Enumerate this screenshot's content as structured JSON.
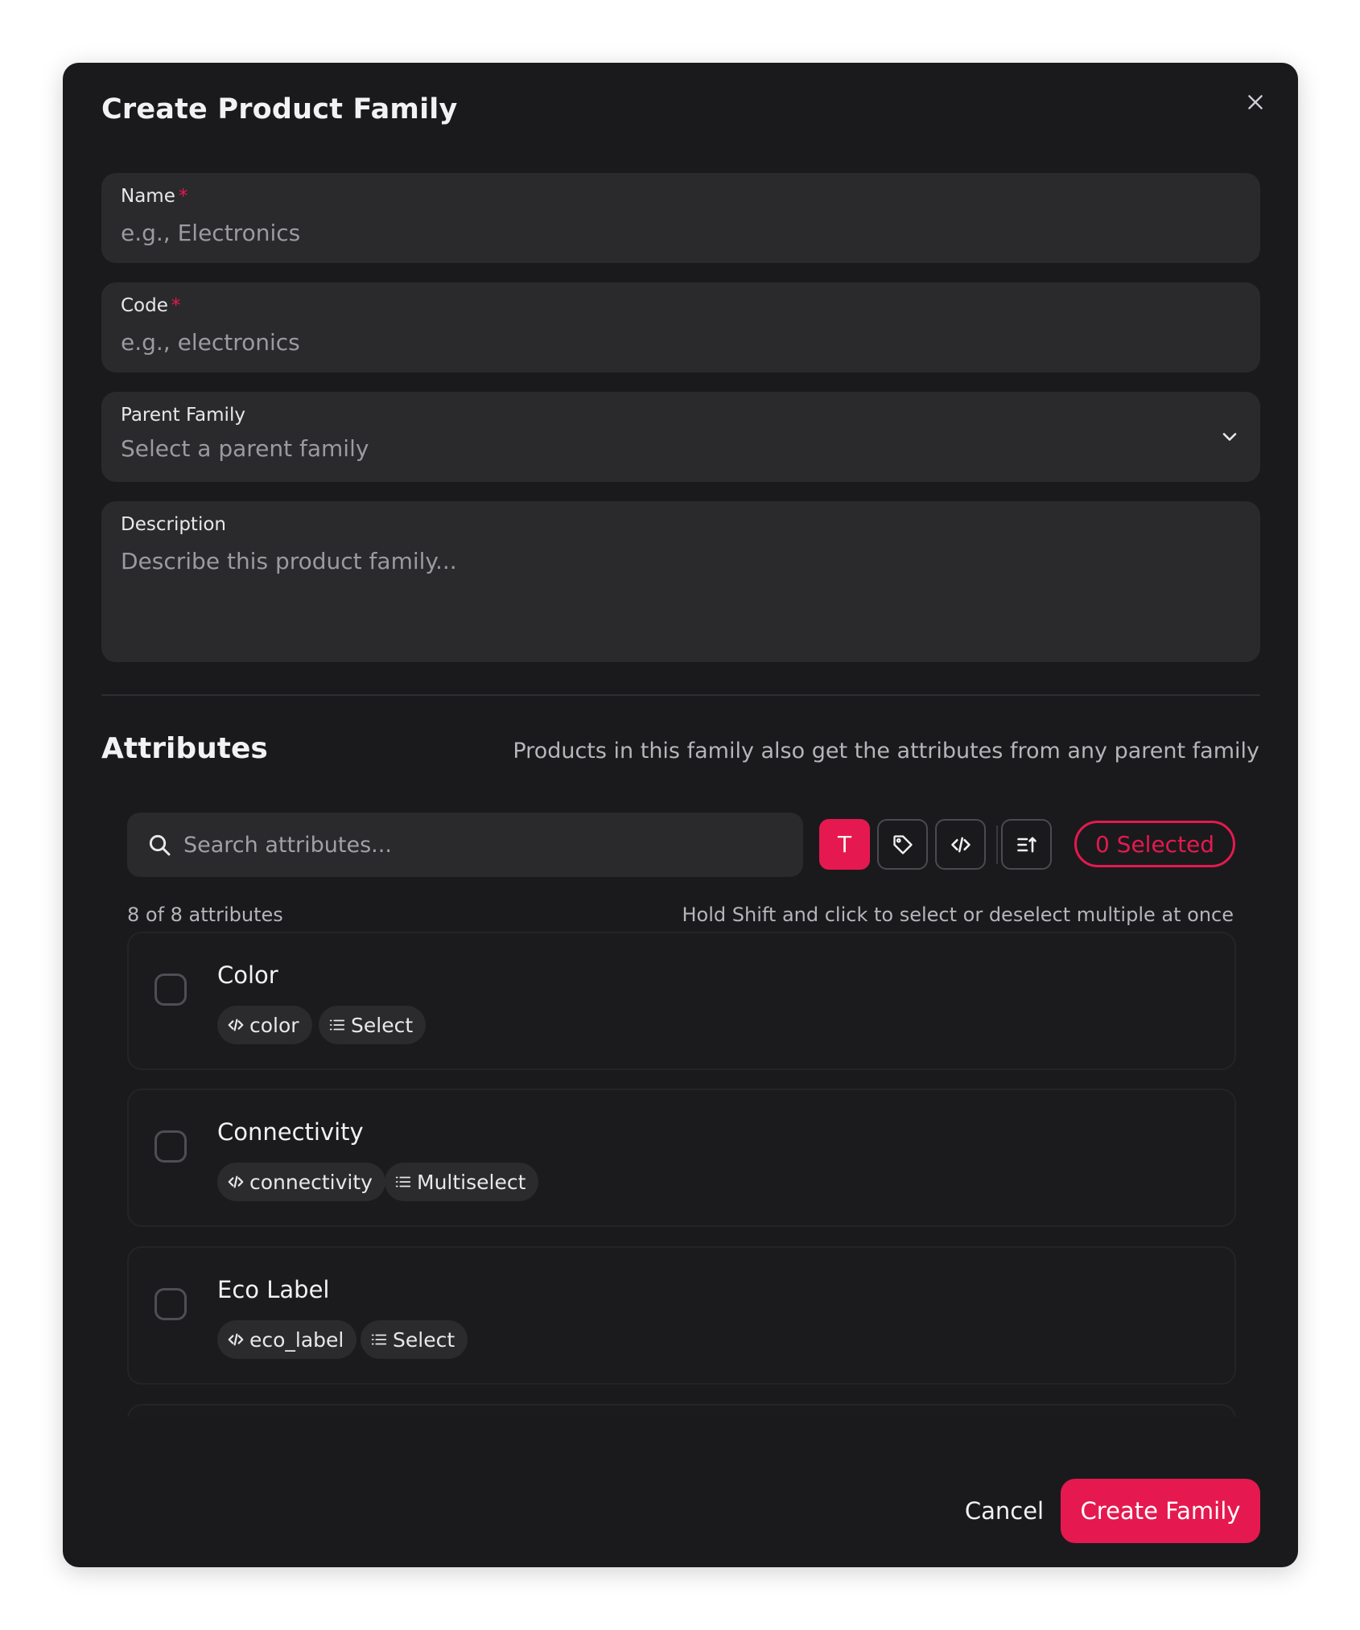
{
  "modal": {
    "title": "Create Product Family"
  },
  "form": {
    "name": {
      "label": "Name",
      "required_mark": "*",
      "placeholder": "e.g., Electronics"
    },
    "code": {
      "label": "Code",
      "required_mark": "*",
      "placeholder": "e.g., electronics"
    },
    "parent": {
      "label": "Parent Family",
      "placeholder": "Select a parent family"
    },
    "description": {
      "label": "Description",
      "placeholder": "Describe this product family..."
    }
  },
  "attributes": {
    "title": "Attributes",
    "hint": "Products in this family also get the attributes from any parent family",
    "search_placeholder": "Search attributes...",
    "text_type_button": "T",
    "selected_label": "0 Selected",
    "count_text": "8 of 8 attributes",
    "shift_hint": "Hold Shift and click to select or deselect multiple at once",
    "items": [
      {
        "name": "Color",
        "code": "color",
        "type": "Select"
      },
      {
        "name": "Connectivity",
        "code": "connectivity",
        "type": "Multiselect"
      },
      {
        "name": "Eco Label",
        "code": "eco_label",
        "type": "Select"
      }
    ]
  },
  "footer": {
    "cancel_label": "Cancel",
    "create_label": "Create Family"
  },
  "colors": {
    "accent": "#e5194f",
    "surface": "#1a1a1c",
    "field": "#2a2a2d"
  },
  "icons": {
    "close": "close-icon",
    "chevron": "chevron-down-icon",
    "search": "search-icon",
    "tag": "tag-icon",
    "code": "code-icon",
    "sort": "sort-icon",
    "list": "list-icon"
  }
}
